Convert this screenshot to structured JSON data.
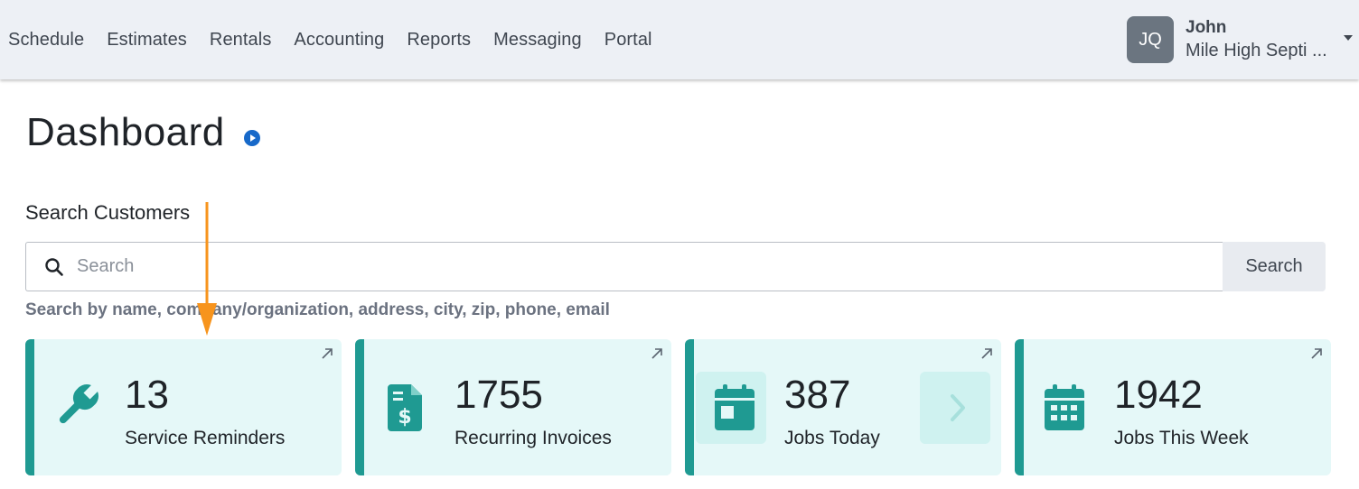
{
  "nav": {
    "items": [
      "Schedule",
      "Estimates",
      "Rentals",
      "Accounting",
      "Reports",
      "Messaging",
      "Portal"
    ]
  },
  "user": {
    "initials": "JQ",
    "name": "John",
    "company": "Mile High Septi ..."
  },
  "page": {
    "title": "Dashboard"
  },
  "search": {
    "label": "Search Customers",
    "placeholder": "Search",
    "button_label": "Search",
    "help": "Search by name, company/organization, address, city, zip, phone, email"
  },
  "cards": [
    {
      "value": "13",
      "label": "Service Reminders",
      "icon": "wrench-icon"
    },
    {
      "value": "1755",
      "label": "Recurring Invoices",
      "icon": "invoice-dollar-icon"
    },
    {
      "value": "387",
      "label": "Jobs Today",
      "icon": "calendar-day-icon"
    },
    {
      "value": "1942",
      "label": "Jobs This Week",
      "icon": "calendar-week-icon"
    }
  ],
  "colors": {
    "accent": "#1f9a92",
    "card_bg": "#e5f8f8",
    "nav_bg": "#edf0f5",
    "annotation": "#f7941d",
    "play": "#1769c9"
  }
}
